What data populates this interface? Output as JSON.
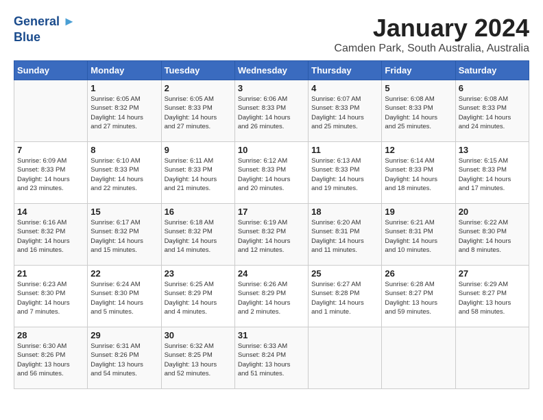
{
  "logo": {
    "line1": "General",
    "line2": "Blue"
  },
  "header": {
    "month_year": "January 2024",
    "location": "Camden Park, South Australia, Australia"
  },
  "days_of_week": [
    "Sunday",
    "Monday",
    "Tuesday",
    "Wednesday",
    "Thursday",
    "Friday",
    "Saturday"
  ],
  "weeks": [
    [
      {
        "num": "",
        "info": ""
      },
      {
        "num": "1",
        "info": "Sunrise: 6:05 AM\nSunset: 8:32 PM\nDaylight: 14 hours\nand 27 minutes."
      },
      {
        "num": "2",
        "info": "Sunrise: 6:05 AM\nSunset: 8:33 PM\nDaylight: 14 hours\nand 27 minutes."
      },
      {
        "num": "3",
        "info": "Sunrise: 6:06 AM\nSunset: 8:33 PM\nDaylight: 14 hours\nand 26 minutes."
      },
      {
        "num": "4",
        "info": "Sunrise: 6:07 AM\nSunset: 8:33 PM\nDaylight: 14 hours\nand 25 minutes."
      },
      {
        "num": "5",
        "info": "Sunrise: 6:08 AM\nSunset: 8:33 PM\nDaylight: 14 hours\nand 25 minutes."
      },
      {
        "num": "6",
        "info": "Sunrise: 6:08 AM\nSunset: 8:33 PM\nDaylight: 14 hours\nand 24 minutes."
      }
    ],
    [
      {
        "num": "7",
        "info": "Sunrise: 6:09 AM\nSunset: 8:33 PM\nDaylight: 14 hours\nand 23 minutes."
      },
      {
        "num": "8",
        "info": "Sunrise: 6:10 AM\nSunset: 8:33 PM\nDaylight: 14 hours\nand 22 minutes."
      },
      {
        "num": "9",
        "info": "Sunrise: 6:11 AM\nSunset: 8:33 PM\nDaylight: 14 hours\nand 21 minutes."
      },
      {
        "num": "10",
        "info": "Sunrise: 6:12 AM\nSunset: 8:33 PM\nDaylight: 14 hours\nand 20 minutes."
      },
      {
        "num": "11",
        "info": "Sunrise: 6:13 AM\nSunset: 8:33 PM\nDaylight: 14 hours\nand 19 minutes."
      },
      {
        "num": "12",
        "info": "Sunrise: 6:14 AM\nSunset: 8:33 PM\nDaylight: 14 hours\nand 18 minutes."
      },
      {
        "num": "13",
        "info": "Sunrise: 6:15 AM\nSunset: 8:33 PM\nDaylight: 14 hours\nand 17 minutes."
      }
    ],
    [
      {
        "num": "14",
        "info": "Sunrise: 6:16 AM\nSunset: 8:32 PM\nDaylight: 14 hours\nand 16 minutes."
      },
      {
        "num": "15",
        "info": "Sunrise: 6:17 AM\nSunset: 8:32 PM\nDaylight: 14 hours\nand 15 minutes."
      },
      {
        "num": "16",
        "info": "Sunrise: 6:18 AM\nSunset: 8:32 PM\nDaylight: 14 hours\nand 14 minutes."
      },
      {
        "num": "17",
        "info": "Sunrise: 6:19 AM\nSunset: 8:32 PM\nDaylight: 14 hours\nand 12 minutes."
      },
      {
        "num": "18",
        "info": "Sunrise: 6:20 AM\nSunset: 8:31 PM\nDaylight: 14 hours\nand 11 minutes."
      },
      {
        "num": "19",
        "info": "Sunrise: 6:21 AM\nSunset: 8:31 PM\nDaylight: 14 hours\nand 10 minutes."
      },
      {
        "num": "20",
        "info": "Sunrise: 6:22 AM\nSunset: 8:30 PM\nDaylight: 14 hours\nand 8 minutes."
      }
    ],
    [
      {
        "num": "21",
        "info": "Sunrise: 6:23 AM\nSunset: 8:30 PM\nDaylight: 14 hours\nand 7 minutes."
      },
      {
        "num": "22",
        "info": "Sunrise: 6:24 AM\nSunset: 8:30 PM\nDaylight: 14 hours\nand 5 minutes."
      },
      {
        "num": "23",
        "info": "Sunrise: 6:25 AM\nSunset: 8:29 PM\nDaylight: 14 hours\nand 4 minutes."
      },
      {
        "num": "24",
        "info": "Sunrise: 6:26 AM\nSunset: 8:29 PM\nDaylight: 14 hours\nand 2 minutes."
      },
      {
        "num": "25",
        "info": "Sunrise: 6:27 AM\nSunset: 8:28 PM\nDaylight: 14 hours\nand 1 minute."
      },
      {
        "num": "26",
        "info": "Sunrise: 6:28 AM\nSunset: 8:27 PM\nDaylight: 13 hours\nand 59 minutes."
      },
      {
        "num": "27",
        "info": "Sunrise: 6:29 AM\nSunset: 8:27 PM\nDaylight: 13 hours\nand 58 minutes."
      }
    ],
    [
      {
        "num": "28",
        "info": "Sunrise: 6:30 AM\nSunset: 8:26 PM\nDaylight: 13 hours\nand 56 minutes."
      },
      {
        "num": "29",
        "info": "Sunrise: 6:31 AM\nSunset: 8:26 PM\nDaylight: 13 hours\nand 54 minutes."
      },
      {
        "num": "30",
        "info": "Sunrise: 6:32 AM\nSunset: 8:25 PM\nDaylight: 13 hours\nand 52 minutes."
      },
      {
        "num": "31",
        "info": "Sunrise: 6:33 AM\nSunset: 8:24 PM\nDaylight: 13 hours\nand 51 minutes."
      },
      {
        "num": "",
        "info": ""
      },
      {
        "num": "",
        "info": ""
      },
      {
        "num": "",
        "info": ""
      }
    ]
  ]
}
